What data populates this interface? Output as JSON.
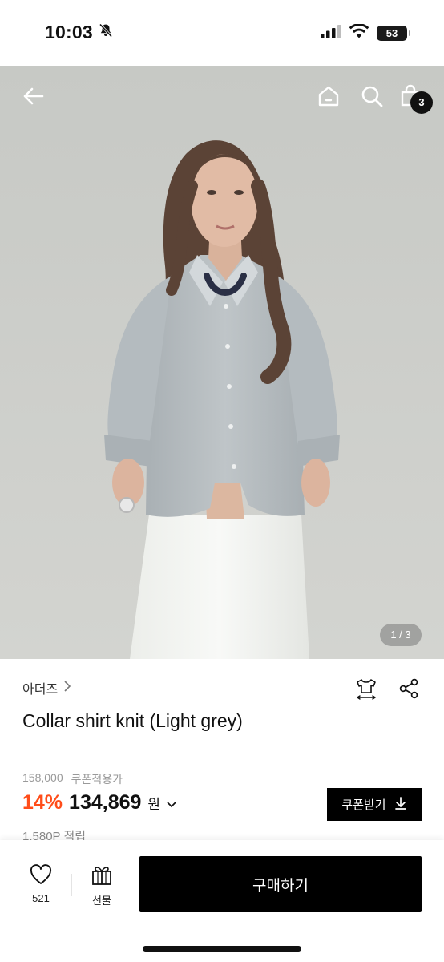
{
  "status_bar": {
    "time": "10:03",
    "battery_level": "53",
    "icons": [
      "bell-slash-icon",
      "cellular-icon",
      "wifi-icon",
      "battery-icon"
    ]
  },
  "nav": {
    "icons": [
      "back-arrow-icon",
      "home-icon",
      "search-icon",
      "shopping-bag-icon"
    ],
    "cart_count": "3"
  },
  "hero": {
    "page_indicator": "1 / 3"
  },
  "product": {
    "brand": "아더즈",
    "brand_chevron": "›",
    "name": "Collar shirt knit (Light grey)",
    "original_price": "158,000",
    "coupon_note": "쿠폰적용가",
    "discount": "14%",
    "price": "134,869",
    "currency": "원",
    "coupon_button": "쿠폰받기",
    "points": "1,580P 적립"
  },
  "tools": {
    "icons": [
      "size-guide-icon",
      "share-icon"
    ]
  },
  "bottom_bar": {
    "like_count": "521",
    "gift_label": "선물",
    "buy_label": "구매하기"
  },
  "colors": {
    "accent_discount": "#ff4d1a",
    "button_bg": "#000000"
  }
}
